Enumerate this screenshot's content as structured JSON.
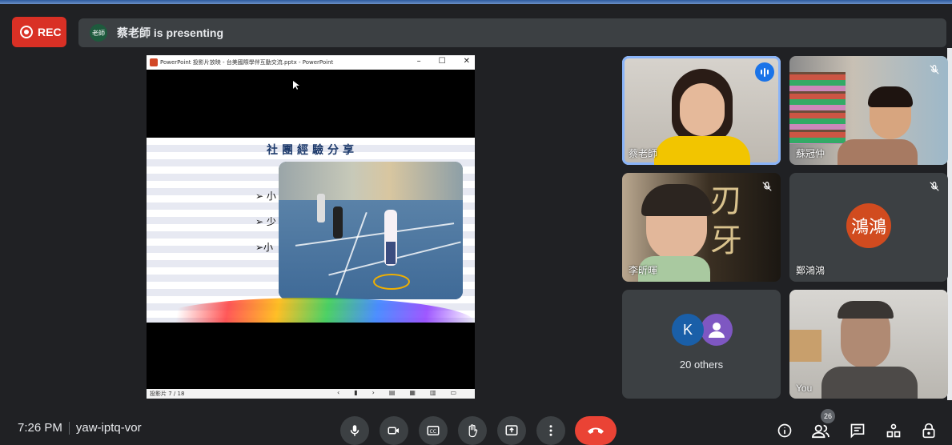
{
  "recording": {
    "label": "REC"
  },
  "presenting": {
    "avatar_text": "老師",
    "text": "蔡老師 is presenting"
  },
  "ppt": {
    "window_title": "PowerPoint 投影片放映 - 台美國際學伴互動交流.pptx - PowerPoint",
    "slide_title": "社團經驗分享",
    "bullets": [
      "➢ 小",
      "➢ 少",
      "➢小"
    ],
    "status": "投影片 7 / 18"
  },
  "participants": [
    {
      "name": "蔡老師",
      "speaking": true
    },
    {
      "name": "蘇冠仲",
      "muted": true
    },
    {
      "name": "李昕暉",
      "muted": true
    },
    {
      "name": "鄭鴻鴻",
      "muted": true,
      "avatar_text": "鴻鴻",
      "avatar_color": "#d14b1f"
    },
    {
      "name": "You"
    }
  ],
  "others": {
    "avatar_letter": "K",
    "label": "20 others"
  },
  "meeting": {
    "time": "7:26 PM",
    "code": "yaw-iptq-vor"
  },
  "people_count": "26",
  "colors": {
    "end_call": "#ea4335",
    "rec": "#d93025",
    "accent": "#8ab4f8"
  }
}
